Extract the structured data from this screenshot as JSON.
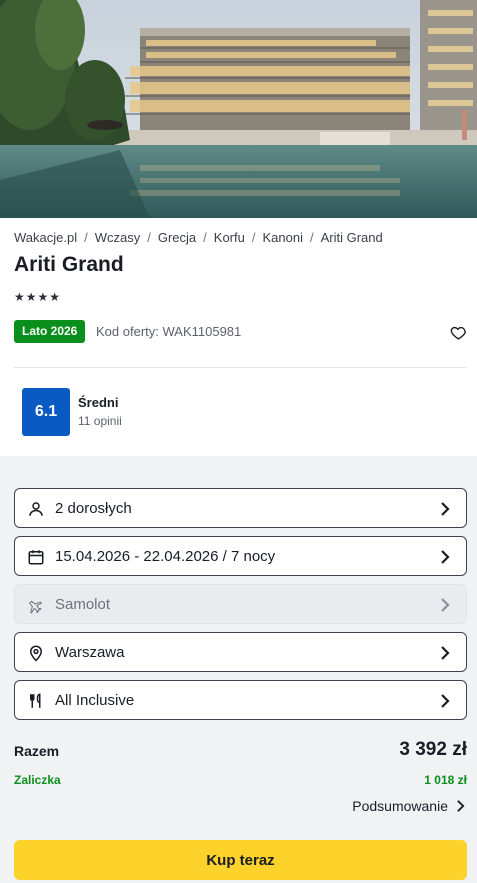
{
  "hero": {
    "image_alt": "Ariti Grand hotel pool view"
  },
  "breadcrumb": [
    "Wakacje.pl",
    "Wczasy",
    "Grecja",
    "Korfu",
    "Kanoni",
    "Ariti Grand"
  ],
  "hotel": {
    "name": "Ariti Grand",
    "stars": "★★★★",
    "star_count": 4
  },
  "offer": {
    "season_badge": "Lato 2026",
    "code_text": "Kod oferty: WAK1105981"
  },
  "rating": {
    "score": "6.1",
    "label": "Średni",
    "reviews": "11 opinii"
  },
  "options": {
    "travellers": "2 dorosłych",
    "dates": "15.04.2026 - 22.04.2026 / 7 nocy",
    "transport": "Samolot",
    "departure": "Warszawa",
    "board": "All Inclusive"
  },
  "price": {
    "total_label": "Razem",
    "total_value": "3 392 zł",
    "deposit_label": "Zaliczka",
    "deposit_value": "1 018 zł",
    "summary_link": "Podsumowanie"
  },
  "cta": {
    "buy_label": "Kup teraz"
  },
  "colors": {
    "brand_green": "#0a8f1d",
    "rating_blue": "#0a5ac4",
    "cta_yellow": "#fcd22b"
  }
}
